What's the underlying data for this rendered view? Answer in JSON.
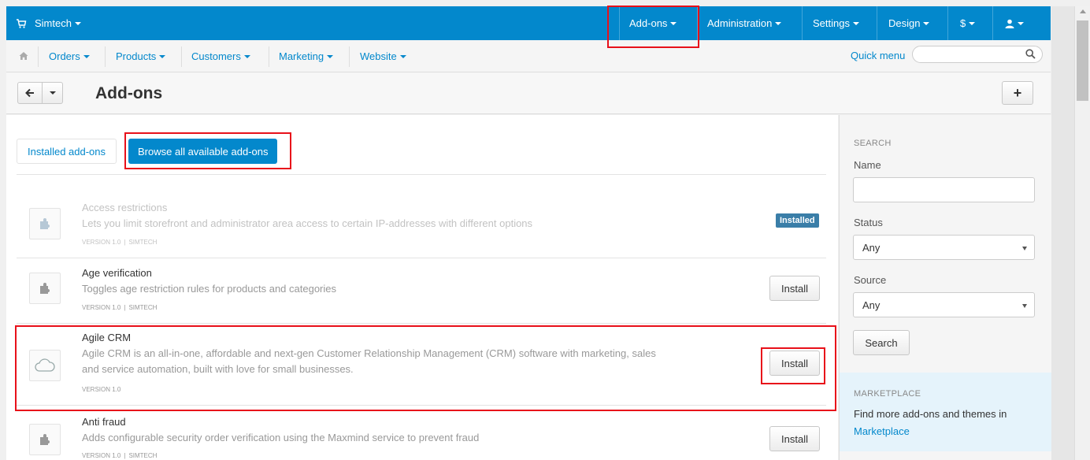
{
  "topbar": {
    "brand": "Simtech",
    "nav": [
      "Add-ons",
      "Administration",
      "Settings",
      "Design",
      "$",
      ""
    ]
  },
  "subbar": {
    "nav": [
      "Orders",
      "Products",
      "Customers",
      "Marketing",
      "Website"
    ],
    "quick_menu": "Quick menu",
    "search_value": ""
  },
  "page": {
    "title": "Add-ons",
    "add_button": "+"
  },
  "tabs": {
    "installed": "Installed add-ons",
    "browse": "Browse all available add-ons"
  },
  "addons": [
    {
      "name": "Access restrictions",
      "description": "Lets you limit storefront and administrator area access to certain IP-addresses with different options",
      "version": "VERSION 1.0",
      "vendor": "SIMTECH",
      "status": "Installed",
      "icon": "puzzle-icon"
    },
    {
      "name": "Age verification",
      "description": "Toggles age restriction rules for products and categories",
      "version": "VERSION 1.0",
      "vendor": "SIMTECH",
      "action": "Install",
      "icon": "puzzle-icon"
    },
    {
      "name": "Agile CRM",
      "description": "Agile CRM is an all-in-one, affordable and next-gen Customer Relationship Management (CRM) software with marketing, sales and service automation, built with love for small businesses.",
      "version": "VERSION 1.0",
      "vendor": "",
      "action": "Install",
      "icon": "cloud-icon"
    },
    {
      "name": "Anti fraud",
      "description": "Adds configurable security order verification using the Maxmind service to prevent fraud",
      "version": "VERSION 1.0",
      "vendor": "SIMTECH",
      "action": "Install",
      "icon": "puzzle-icon"
    }
  ],
  "sidebar": {
    "search_heading": "Search",
    "name_label": "Name",
    "name_value": "",
    "status_label": "Status",
    "status_value": "Any",
    "source_label": "Source",
    "source_value": "Any",
    "search_button": "Search",
    "marketplace_heading": "Marketplace",
    "marketplace_text": "Find more add-ons and themes in",
    "marketplace_link": "Marketplace"
  },
  "colors": {
    "primary": "#0388cc",
    "highlight": "#e8101a",
    "badge": "#3a7ea8"
  }
}
